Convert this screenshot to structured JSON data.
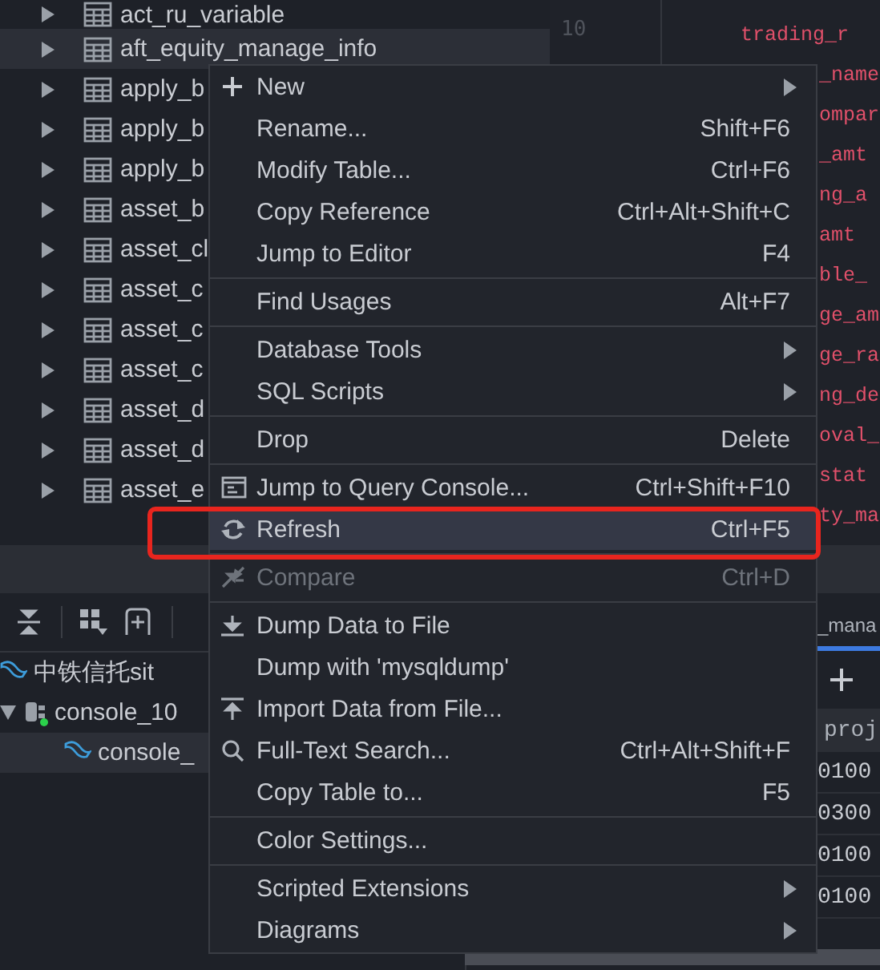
{
  "db_tree": {
    "items": [
      {
        "label": "act_ru_variable",
        "selected": false
      },
      {
        "label": "aft_equity_manage_info",
        "selected": true
      },
      {
        "label": "apply_b",
        "selected": false
      },
      {
        "label": "apply_b",
        "selected": false
      },
      {
        "label": "apply_b",
        "selected": false
      },
      {
        "label": "asset_b",
        "selected": false
      },
      {
        "label": "asset_cl",
        "selected": false
      },
      {
        "label": "asset_c",
        "selected": false
      },
      {
        "label": "asset_c",
        "selected": false
      },
      {
        "label": "asset_c",
        "selected": false
      },
      {
        "label": "asset_d",
        "selected": false
      },
      {
        "label": "asset_d",
        "selected": false
      },
      {
        "label": "asset_e",
        "selected": false
      }
    ]
  },
  "editor": {
    "line_number": "10",
    "code_lines": [
      "trading_r",
      "_name",
      "ompar",
      "_amt",
      "ng_a",
      "amt",
      "ble_",
      "ge_am",
      "ge_ra",
      "ng_de",
      "oval_",
      "stat",
      "ty_ma"
    ]
  },
  "services": {
    "items": [
      {
        "kind": "datasource",
        "label": "中铁信托sit",
        "selected": false
      },
      {
        "kind": "console",
        "label": "console_10",
        "selected": false,
        "expanded": true,
        "children": [
          {
            "kind": "session",
            "label": "console_",
            "selected": true
          }
        ]
      }
    ]
  },
  "results": {
    "tab": {
      "label": "_mana",
      "selected": true
    },
    "column": "proj",
    "rows": [
      "0100",
      "0300",
      "0100",
      "0100"
    ]
  },
  "context_menu": {
    "items": [
      {
        "kind": "item",
        "label": "New",
        "submenu": true,
        "selected": false,
        "disabled": false
      },
      {
        "kind": "item",
        "label": "Rename...",
        "shortcut": "Shift+F6",
        "submenu": false,
        "selected": false,
        "disabled": false
      },
      {
        "kind": "item",
        "label": "Modify Table...",
        "shortcut": "Ctrl+F6",
        "submenu": false,
        "selected": false,
        "disabled": false
      },
      {
        "kind": "item",
        "label": "Copy Reference",
        "shortcut": "Ctrl+Alt+Shift+C",
        "submenu": false,
        "selected": false,
        "disabled": false
      },
      {
        "kind": "item",
        "label": "Jump to Editor",
        "shortcut": "F4",
        "submenu": false,
        "selected": false,
        "disabled": false
      },
      {
        "kind": "separator"
      },
      {
        "kind": "item",
        "label": "Find Usages",
        "shortcut": "Alt+F7",
        "submenu": false,
        "selected": false,
        "disabled": false
      },
      {
        "kind": "separator"
      },
      {
        "kind": "item",
        "label": "Database Tools",
        "submenu": true,
        "selected": false,
        "disabled": false
      },
      {
        "kind": "item",
        "label": "SQL Scripts",
        "submenu": true,
        "selected": false,
        "disabled": false
      },
      {
        "kind": "separator"
      },
      {
        "kind": "item",
        "label": "Drop",
        "shortcut": "Delete",
        "submenu": false,
        "selected": false,
        "disabled": false
      },
      {
        "kind": "separator"
      },
      {
        "kind": "item",
        "label": "Jump to Query Console...",
        "shortcut": "Ctrl+Shift+F10",
        "submenu": false,
        "selected": false,
        "disabled": false
      },
      {
        "kind": "item",
        "label": "Refresh",
        "shortcut": "Ctrl+F5",
        "submenu": false,
        "selected": true,
        "disabled": false
      },
      {
        "kind": "separator"
      },
      {
        "kind": "item",
        "label": "Compare",
        "shortcut": "Ctrl+D",
        "submenu": false,
        "selected": false,
        "disabled": true
      },
      {
        "kind": "separator"
      },
      {
        "kind": "item",
        "label": "Dump Data to File",
        "submenu": false,
        "selected": false,
        "disabled": false
      },
      {
        "kind": "item",
        "label": "Dump with 'mysqldump'",
        "submenu": false,
        "selected": false,
        "disabled": false
      },
      {
        "kind": "item",
        "label": "Import Data from File...",
        "submenu": false,
        "selected": false,
        "disabled": false
      },
      {
        "kind": "item",
        "label": "Full-Text Search...",
        "shortcut": "Ctrl+Alt+Shift+F",
        "submenu": false,
        "selected": false,
        "disabled": false
      },
      {
        "kind": "item",
        "label": "Copy Table to...",
        "shortcut": "F5",
        "submenu": false,
        "selected": false,
        "disabled": false
      },
      {
        "kind": "separator"
      },
      {
        "kind": "item",
        "label": "Color Settings...",
        "submenu": false,
        "selected": false,
        "disabled": false
      },
      {
        "kind": "separator"
      },
      {
        "kind": "item",
        "label": "Scripted Extensions",
        "submenu": true,
        "selected": false,
        "disabled": false
      },
      {
        "kind": "item",
        "label": "Diagrams",
        "submenu": true,
        "selected": false,
        "disabled": false
      }
    ]
  }
}
